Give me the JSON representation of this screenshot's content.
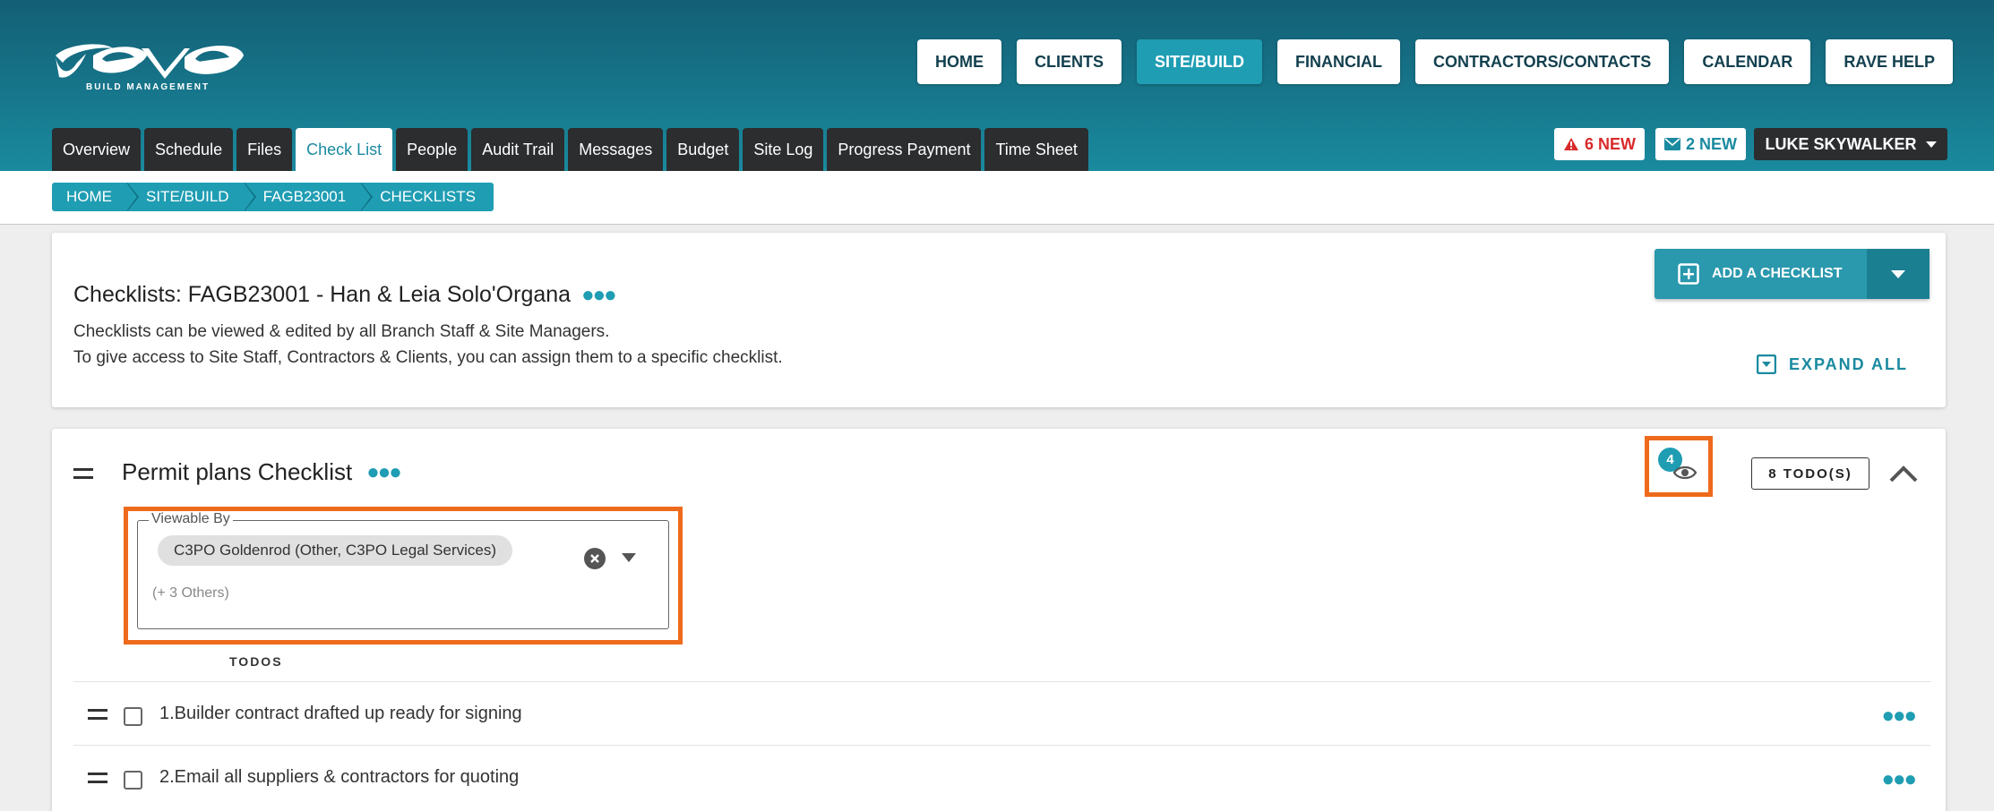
{
  "logo": {
    "alt": "rave",
    "tagline": "BUILD MANAGEMENT"
  },
  "topnav": [
    {
      "label": "HOME",
      "active": false
    },
    {
      "label": "CLIENTS",
      "active": false
    },
    {
      "label": "SITE/BUILD",
      "active": true
    },
    {
      "label": "FINANCIAL",
      "active": false
    },
    {
      "label": "CONTRACTORS/CONTACTS",
      "active": false
    },
    {
      "label": "CALENDAR",
      "active": false
    },
    {
      "label": "RAVE HELP",
      "active": false
    }
  ],
  "tabs": [
    {
      "label": "Overview"
    },
    {
      "label": "Schedule"
    },
    {
      "label": "Files"
    },
    {
      "label": "Check List",
      "active": true
    },
    {
      "label": "People"
    },
    {
      "label": "Audit Trail"
    },
    {
      "label": "Messages"
    },
    {
      "label": "Budget"
    },
    {
      "label": "Site Log"
    },
    {
      "label": "Progress Payment"
    },
    {
      "label": "Time Sheet"
    }
  ],
  "notifications": {
    "alerts": {
      "label": "6 NEW",
      "icon": "warning-icon"
    },
    "messages": {
      "label": "2 NEW",
      "icon": "envelope-icon"
    }
  },
  "user": {
    "name": "LUKE SKYWALKER"
  },
  "breadcrumb": [
    "HOME",
    "SITE/BUILD",
    "FAGB23001",
    "CHECKLISTS"
  ],
  "header_card": {
    "title": "Checklists: FAGB23001 - Han & Leia Solo'Organa",
    "description_line1": "Checklists can be viewed & edited by all Branch Staff & Site Managers.",
    "description_line2": "To give access to Site Staff, Contractors & Clients, you can assign them to a specific checklist.",
    "add_button": "ADD A CHECKLIST",
    "expand_all": "EXPAND ALL"
  },
  "checklist": {
    "title": "Permit plans Checklist",
    "viewer_count": "4",
    "todo_count": "8 TODO(S)",
    "viewable_by": {
      "legend": "Viewable By",
      "chip": "C3PO Goldenrod (Other, C3PO Legal Services)",
      "others": "(+ 3 Others)"
    },
    "todos_label": "TODOS",
    "todos": [
      {
        "text": "1.Builder contract drafted up ready for signing",
        "checked": false
      },
      {
        "text": "2.Email all suppliers & contractors for quoting",
        "checked": false
      }
    ]
  },
  "colors": {
    "header_top": "#135f75",
    "header_bottom": "#1a8a9e",
    "accent": "#1f9db3",
    "highlight": "#ee6a1c",
    "alert": "#d92a2a"
  }
}
